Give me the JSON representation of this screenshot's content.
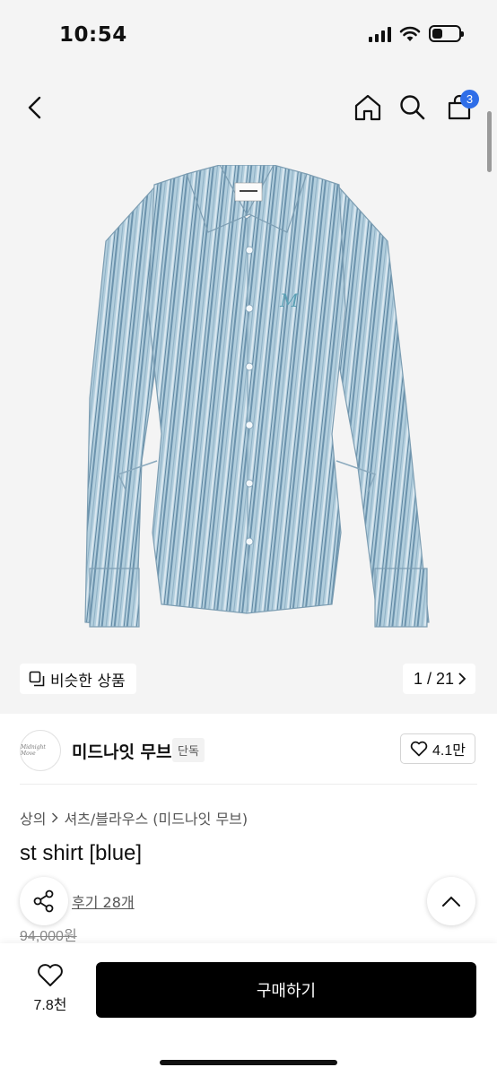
{
  "status_bar": {
    "time": "10:54",
    "battery_level": 0.4
  },
  "nav": {
    "cart_count": "3"
  },
  "gallery": {
    "similar_label": "비슷한 상품",
    "counter": "1 / 21",
    "shirt_label_text": "MIDNIGHT"
  },
  "brand": {
    "logo_text": "Midnight Move",
    "name": "미드나잇 무브",
    "tag": "단독",
    "likes": "4.1만"
  },
  "product": {
    "breadcrumb": [
      "상의",
      "셔츠/블라우스 (미드나잇 무브)"
    ],
    "title": "st shirt [blue]",
    "reviews": "후기 28개",
    "original_price": "94,000원"
  },
  "bottom_bar": {
    "wish_count": "7.8천",
    "buy_label": "구매하기"
  },
  "colors": {
    "shirt": "#a9c7d8",
    "stripe": "#6c93ad",
    "accent": "#2f6ee8",
    "button": "#000000"
  }
}
